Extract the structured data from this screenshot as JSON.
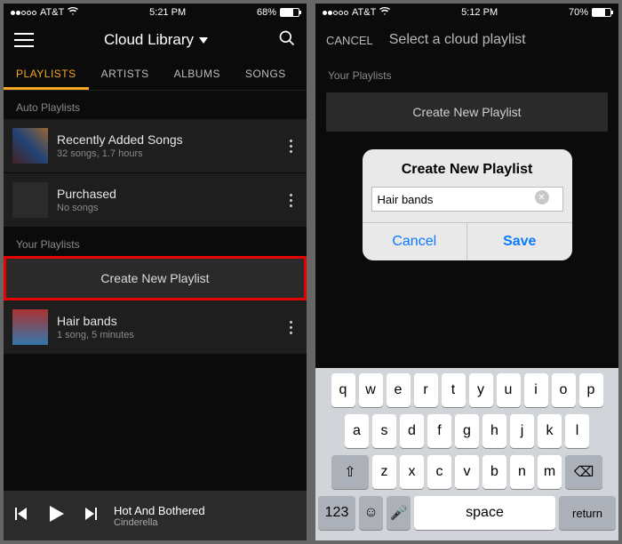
{
  "left": {
    "status": {
      "carrier": "AT&T",
      "time": "5:21 PM",
      "battery": "68%",
      "battFill": "68%"
    },
    "header": {
      "title": "Cloud Library"
    },
    "tabs": [
      "PLAYLISTS",
      "ARTISTS",
      "ALBUMS",
      "SONGS"
    ],
    "activeTab": 0,
    "autoLabel": "Auto Playlists",
    "auto": [
      {
        "title": "Recently Added Songs",
        "sub": "32 songs, 1.7 hours"
      },
      {
        "title": "Purchased",
        "sub": "No songs"
      }
    ],
    "yourLabel": "Your Playlists",
    "createLabel": "Create New Playlist",
    "your": [
      {
        "title": "Hair bands",
        "sub": "1 song, 5 minutes"
      }
    ],
    "player": {
      "title": "Hot And Bothered",
      "artist": "Cinderella"
    }
  },
  "right": {
    "status": {
      "carrier": "AT&T",
      "time": "5:12 PM",
      "battery": "70%",
      "battFill": "70%"
    },
    "nav": {
      "cancel": "CANCEL",
      "title": "Select a cloud playlist"
    },
    "yourLabel": "Your Playlists",
    "createLabel": "Create New Playlist",
    "dialog": {
      "title": "Create New Playlist",
      "value": "Hair bands",
      "cancel": "Cancel",
      "save": "Save"
    },
    "keyboard": {
      "r1": [
        "q",
        "w",
        "e",
        "r",
        "t",
        "y",
        "u",
        "i",
        "o",
        "p"
      ],
      "r2": [
        "a",
        "s",
        "d",
        "f",
        "g",
        "h",
        "j",
        "k",
        "l"
      ],
      "r3": [
        "z",
        "x",
        "c",
        "v",
        "b",
        "n",
        "m"
      ],
      "num": "123",
      "space": "space",
      "ret": "return"
    }
  }
}
